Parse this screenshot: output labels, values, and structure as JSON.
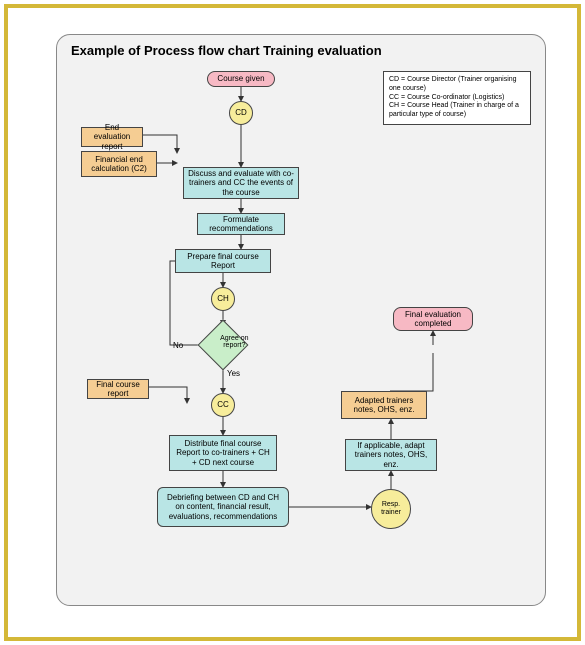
{
  "title": "Example of Process flow chart Training evaluation",
  "legend": {
    "l1": "CD = Course Director (Trainer organising one course)",
    "l2": "CC = Course Co-ordinator (Logistics)",
    "l3": "CH = Course Head (Trainer in charge of a particular type of course)"
  },
  "nodes": {
    "start": "Course given",
    "cd": "CD",
    "endEval": "End evaluation report",
    "finCalc": "Financial end calculation (C2)",
    "discuss": "Discuss and evaluate with co-trainers and CC the events of the course",
    "formulate": "Formulate recommendations",
    "prepare": "Prepare final course Report",
    "ch": "CH",
    "agree": "Agree on report?",
    "finalReport": "Final course report",
    "cc": "CC",
    "distribute": "Distribute final course Report to co-trainers + CH + CD next course",
    "debrief": "Debriefing between CD and CH on content, financial result, evaluations, recommendations",
    "resp": "Resp. trainer",
    "adapt": "If applicable, adapt trainers notes, OHS, enz.",
    "adapted": "Adapted trainers notes, OHS, enz.",
    "finalEval": "Final evaluation completed"
  },
  "labels": {
    "yes": "Yes",
    "no": "No"
  }
}
